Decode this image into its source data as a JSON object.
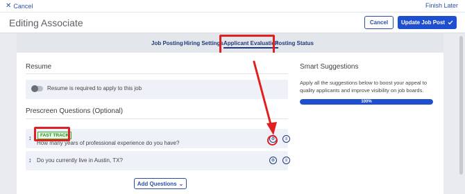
{
  "topbar": {
    "cancel_label": "Cancel",
    "finish_later_label": "Finish Later"
  },
  "header": {
    "title": "Editing Associate",
    "cancel_button": "Cancel",
    "update_button": "Update Job Post"
  },
  "tabs": [
    {
      "label": "Job Posting",
      "active": false
    },
    {
      "label": "Hiring Settings",
      "active": false
    },
    {
      "label": "Applicant Evaluation",
      "active": true
    },
    {
      "label": "Posting Status",
      "active": false
    }
  ],
  "resume": {
    "title": "Resume",
    "toggle_on": false,
    "toggle_label": "Resume is required to apply to this job"
  },
  "prescreen": {
    "title": "Prescreen Questions (Optional)",
    "questions": [
      {
        "text": "How many years of professional experience do you have?",
        "badge": "FAST TRACK"
      },
      {
        "text": "Do you currently live in Austin, TX?",
        "badge": ""
      }
    ],
    "add_button": "Add Questions"
  },
  "smart": {
    "title": "Smart Suggestions",
    "description": "Apply all the suggestions below to boost your appeal to quality applicants and improve visibility on job boards.",
    "progress": 1.0,
    "progress_label": "100%"
  },
  "colors": {
    "accent": "#1e4fcf",
    "highlight": "#e02020",
    "fast_track": "#2b8e23"
  },
  "icons": [
    "close-icon",
    "checkmark-icon",
    "drag-handle-icon",
    "fast-track-settings-icon",
    "options-icon",
    "chevron-down-icon",
    "arrow-annotation-icon"
  ]
}
